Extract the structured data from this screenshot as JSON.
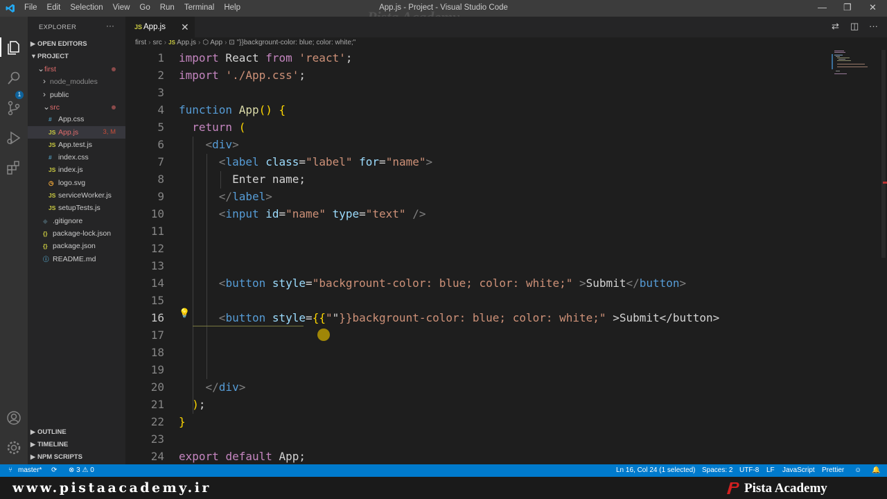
{
  "titlebar": {
    "menu": [
      "File",
      "Edit",
      "Selection",
      "View",
      "Go",
      "Run",
      "Terminal",
      "Help"
    ],
    "title": "App.js - Project - Visual Studio Code",
    "watermark": "Pista Academy"
  },
  "explorer": {
    "title": "EXPLORER",
    "more": "···",
    "open_editors": "OPEN EDITORS",
    "project": "PROJECT",
    "items": [
      {
        "label": "first",
        "type": "folder",
        "indent": 1,
        "open": true,
        "color": "#e06c6c"
      },
      {
        "label": "node_modules",
        "type": "folder",
        "indent": 2,
        "open": false,
        "color": "#8c8c8c"
      },
      {
        "label": "public",
        "type": "folder",
        "indent": 2,
        "open": false,
        "color": "#cccccc"
      },
      {
        "label": "src",
        "type": "folder",
        "indent": 2,
        "open": true,
        "color": "#e06c6c"
      },
      {
        "label": "App.css",
        "type": "css",
        "indent": 3,
        "color": "#cccccc"
      },
      {
        "label": "App.js",
        "type": "js",
        "indent": 3,
        "color": "#e06c6c",
        "badge": "3, M",
        "selected": true
      },
      {
        "label": "App.test.js",
        "type": "js",
        "indent": 3,
        "color": "#cccccc"
      },
      {
        "label": "index.css",
        "type": "css",
        "indent": 3,
        "color": "#cccccc"
      },
      {
        "label": "index.js",
        "type": "js",
        "indent": 3,
        "color": "#cccccc"
      },
      {
        "label": "logo.svg",
        "type": "svg",
        "indent": 3,
        "color": "#cccccc"
      },
      {
        "label": "serviceWorker.js",
        "type": "js",
        "indent": 3,
        "color": "#cccccc"
      },
      {
        "label": "setupTests.js",
        "type": "js",
        "indent": 3,
        "color": "#cccccc"
      },
      {
        "label": ".gitignore",
        "type": "git",
        "indent": 2,
        "color": "#cccccc"
      },
      {
        "label": "package-lock.json",
        "type": "json",
        "indent": 2,
        "color": "#cccccc"
      },
      {
        "label": "package.json",
        "type": "json",
        "indent": 2,
        "color": "#cccccc"
      },
      {
        "label": "README.md",
        "type": "md",
        "indent": 2,
        "color": "#cccccc"
      }
    ],
    "outline": "OUTLINE",
    "timeline": "TIMELINE",
    "npm_scripts": "NPM SCRIPTS"
  },
  "tab": {
    "icon": "JS",
    "label": "App.js",
    "close": "✕"
  },
  "breadcrumb": [
    "first",
    "src",
    "App.js",
    "App",
    "\"}}backgrount-color: blue; color: white;\""
  ],
  "editor": {
    "current_line": 16,
    "lines": [
      [
        [
          "kw",
          "import"
        ],
        [
          "txt",
          " React "
        ],
        [
          "kw",
          "from"
        ],
        [
          "txt",
          " "
        ],
        [
          "str",
          "'react'"
        ],
        [
          "txt",
          ";"
        ]
      ],
      [
        [
          "kw",
          "import"
        ],
        [
          "txt",
          " "
        ],
        [
          "str",
          "'./App.css'"
        ],
        [
          "txt",
          ";"
        ]
      ],
      [],
      [
        [
          "kb",
          "function"
        ],
        [
          "txt",
          " "
        ],
        [
          "fn",
          "App"
        ],
        [
          "brk",
          "()"
        ],
        [
          "txt",
          " "
        ],
        [
          "brk",
          "{"
        ]
      ],
      [
        [
          "txt",
          "  "
        ],
        [
          "kw",
          "return"
        ],
        [
          "txt",
          " "
        ],
        [
          "brk",
          "("
        ]
      ],
      [
        [
          "txt",
          "    "
        ],
        [
          "ang",
          "<"
        ],
        [
          "tag",
          "div"
        ],
        [
          "ang",
          ">"
        ]
      ],
      [
        [
          "txt",
          "      "
        ],
        [
          "ang",
          "<"
        ],
        [
          "tag",
          "label"
        ],
        [
          "txt",
          " "
        ],
        [
          "attr",
          "class"
        ],
        [
          "txt",
          "="
        ],
        [
          "str",
          "\"label\""
        ],
        [
          "txt",
          " "
        ],
        [
          "attr",
          "for"
        ],
        [
          "txt",
          "="
        ],
        [
          "str",
          "\"name\""
        ],
        [
          "ang",
          ">"
        ]
      ],
      [
        [
          "txt",
          "        Enter name;"
        ]
      ],
      [
        [
          "txt",
          "      "
        ],
        [
          "ang",
          "</"
        ],
        [
          "tag",
          "label"
        ],
        [
          "ang",
          ">"
        ]
      ],
      [
        [
          "txt",
          "      "
        ],
        [
          "ang",
          "<"
        ],
        [
          "tag",
          "input"
        ],
        [
          "txt",
          " "
        ],
        [
          "attr",
          "id"
        ],
        [
          "txt",
          "="
        ],
        [
          "str",
          "\"name\""
        ],
        [
          "txt",
          " "
        ],
        [
          "attr",
          "type"
        ],
        [
          "txt",
          "="
        ],
        [
          "str",
          "\"text\""
        ],
        [
          "txt",
          " "
        ],
        [
          "ang",
          "/>"
        ]
      ],
      [],
      [],
      [],
      [
        [
          "txt",
          "      "
        ],
        [
          "ang",
          "<"
        ],
        [
          "tag",
          "button"
        ],
        [
          "txt",
          " "
        ],
        [
          "attr",
          "style"
        ],
        [
          "txt",
          "="
        ],
        [
          "str",
          "\"backgrount-color: blue; color: white;\""
        ],
        [
          "txt",
          " "
        ],
        [
          "ang",
          ">"
        ],
        [
          "txt",
          "Submit"
        ],
        [
          "ang",
          "</"
        ],
        [
          "tag",
          "button"
        ],
        [
          "ang",
          ">"
        ]
      ],
      [],
      [
        [
          "txt",
          "      "
        ],
        [
          "ang",
          "<"
        ],
        [
          "tag",
          "button"
        ],
        [
          "txt",
          " "
        ],
        [
          "attr",
          "style"
        ],
        [
          "txt",
          "="
        ],
        [
          "brk",
          "{{"
        ],
        [
          "str",
          "\""
        ],
        [
          "txt",
          "\""
        ],
        [
          "str",
          "}}backgrount-color: blue; color: white;\""
        ],
        [
          "txt",
          " "
        ],
        [
          "txt",
          ">Submit</button>"
        ]
      ],
      [],
      [],
      [],
      [
        [
          "txt",
          "    "
        ],
        [
          "ang",
          "</"
        ],
        [
          "tag",
          "div"
        ],
        [
          "ang",
          ">"
        ]
      ],
      [
        [
          "txt",
          "  "
        ],
        [
          "brk",
          ")"
        ],
        [
          "txt",
          ";"
        ]
      ],
      [
        [
          "brk",
          "}"
        ]
      ],
      [],
      [
        [
          "kw",
          "export"
        ],
        [
          "txt",
          " "
        ],
        [
          "kw",
          "default"
        ],
        [
          "txt",
          " App;"
        ]
      ]
    ]
  },
  "statusbar": {
    "branch": "master*",
    "problems": "⊗ 3 ⚠ 0",
    "position": "Ln 16, Col 24 (1 selected)",
    "spaces": "Spaces: 2",
    "encoding": "UTF-8",
    "eol": "LF",
    "language": "JavaScript",
    "formatter": "Prettier"
  },
  "footer": {
    "site": "www.pistaacademy.ir",
    "brand": "Pista Academy"
  },
  "colors": {
    "accent": "#007acc",
    "activity_bar": "#333333",
    "sidebar": "#252526",
    "editor_bg": "#1e1e1e"
  }
}
